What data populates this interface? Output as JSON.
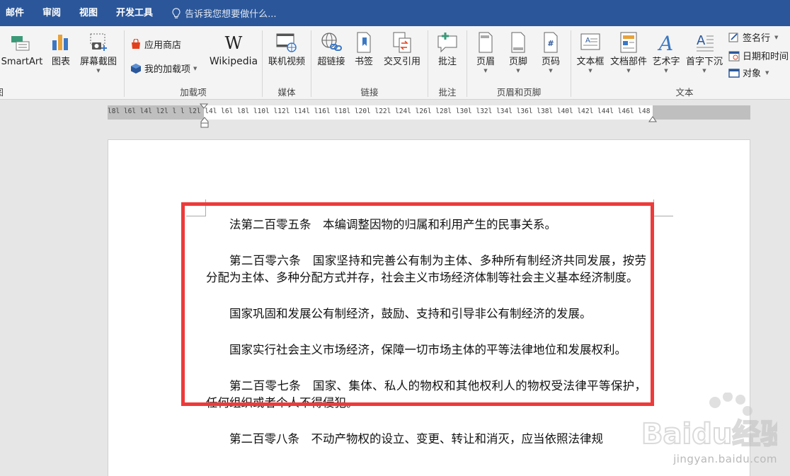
{
  "tabs": [
    "邮件",
    "审阅",
    "视图",
    "开发工具"
  ],
  "tell_me": "告诉我您想要做什么...",
  "ribbon": {
    "illustrations": {
      "smartart": "SmartArt",
      "chart": "图表",
      "screenshot": "屏幕截图",
      "group_label": "插图"
    },
    "addins": {
      "store": "应用商店",
      "my_addins": "我的加载项",
      "wikipedia": "Wikipedia",
      "group_label": "加载项"
    },
    "media": {
      "online_video": "联机视频",
      "group_label": "媒体"
    },
    "links": {
      "hyperlink": "超链接",
      "bookmark": "书签",
      "cross_ref": "交叉引用",
      "group_label": "链接"
    },
    "comments": {
      "comment": "批注",
      "group_label": "批注"
    },
    "header_footer": {
      "header": "页眉",
      "footer": "页脚",
      "page_number": "页码",
      "group_label": "页眉和页脚"
    },
    "text": {
      "textbox": "文本框",
      "quick_parts": "文档部件",
      "wordart": "艺术字",
      "dropcap": "首字下沉",
      "signature": "签名行",
      "datetime": "日期和时间",
      "object": "对象",
      "group_label": "文本"
    }
  },
  "ruler_text": "l8l  l6l  l4l  l2l  l   l  l2l  l4l  l6l  l8l  l10l l12l l14l l16l l18l l20l l22l l24l l26l l28l l30l l32l l34l l36l l38l  l40l l42l l44l l46l l48",
  "document": {
    "paragraphs": [
      "法第二百零五条　本编调整因物的归属和利用产生的民事关系。",
      "第二百零六条　国家坚持和完善公有制为主体、多种所有制经济共同发展，按劳分配为主体、多种分配方式并存，社会主义市场经济体制等社会主义基本经济制度。",
      "国家巩固和发展公有制经济，鼓励、支持和引导非公有制经济的发展。",
      "国家实行社会主义市场经济，保障一切市场主体的平等法律地位和发展权利。",
      "第二百零七条　国家、集体、私人的物权和其他权利人的物权受法律平等保护，任何组织或者个人不得侵犯。",
      "第二百零八条　不动产物权的设立、变更、转让和消灭，应当依照法律规"
    ]
  },
  "watermark": {
    "logo_text": "Baidu经验",
    "sub": "jingyan.baidu.com"
  },
  "colors": {
    "accent": "#2b579a",
    "highlight": "#ee3a3a"
  }
}
